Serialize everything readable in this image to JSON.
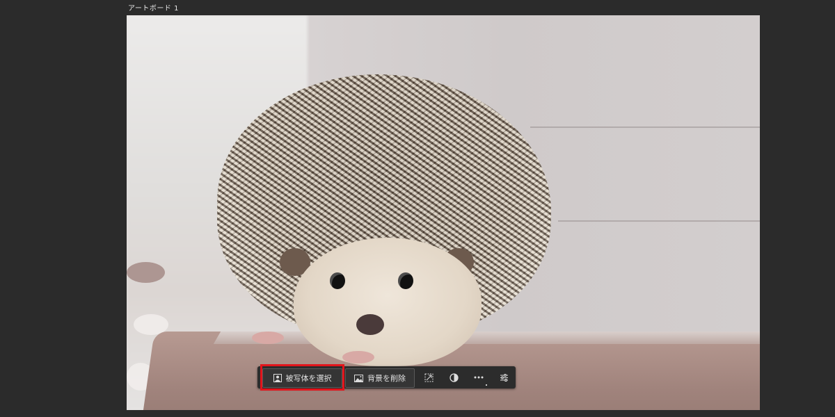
{
  "artboard": {
    "title": "アートボード 1"
  },
  "image": {
    "subject": "hedgehog"
  },
  "toolbar": {
    "select_subject_label": "被写体を選択",
    "remove_background_label": "背景を削除",
    "icons": [
      "person-icon",
      "image-icon",
      "transform-icon",
      "contrast-icon",
      "more-icon",
      "adjustments-icon"
    ]
  },
  "colors": {
    "highlight": "#e3141b",
    "toolbar_bg": "#2c2c2c",
    "app_bg": "#2b2b2b"
  }
}
